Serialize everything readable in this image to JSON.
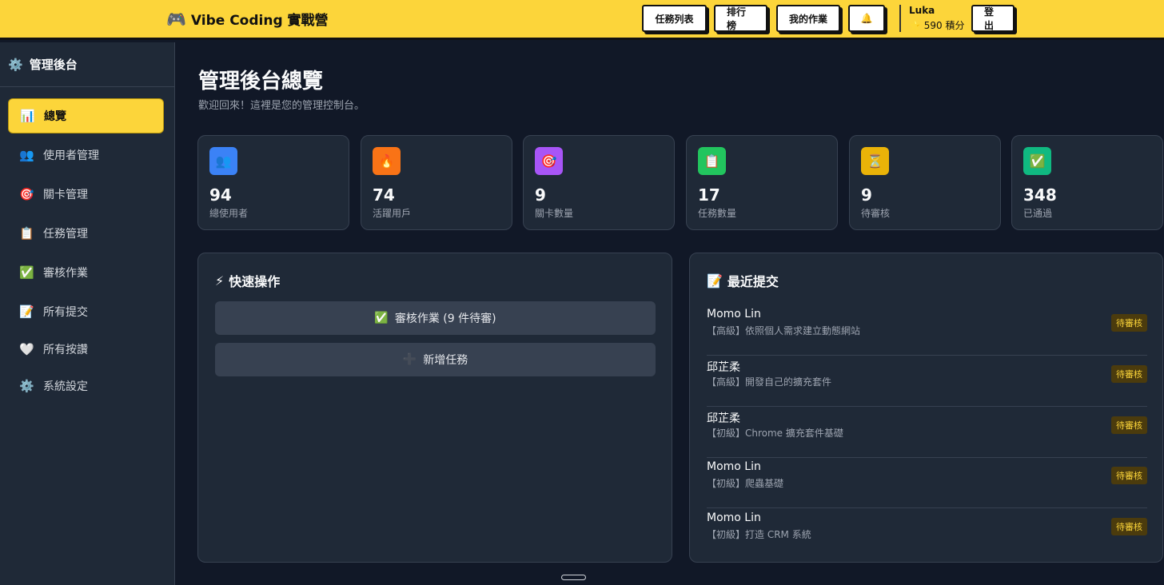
{
  "header": {
    "brand_icon": "🎮",
    "brand": "Vibe Coding 實戰營",
    "nav": [
      "任務列表",
      "排行榜",
      "我的作業"
    ],
    "bell_icon": "🔔",
    "user_name": "Luka",
    "points_icon": "⭐",
    "points": "590 積分",
    "logout": "登出"
  },
  "sidebar": {
    "title_icon": "⚙️",
    "title": "管理後台",
    "items": [
      {
        "icon": "📊",
        "label": "總覽"
      },
      {
        "icon": "👥",
        "label": "使用者管理"
      },
      {
        "icon": "🎯",
        "label": "關卡管理"
      },
      {
        "icon": "📋",
        "label": "任務管理"
      },
      {
        "icon": "✅",
        "label": "審核作業"
      },
      {
        "icon": "📝",
        "label": "所有提交"
      },
      {
        "icon": "🤍",
        "label": "所有按讚"
      },
      {
        "icon": "⚙️",
        "label": "系統設定"
      }
    ]
  },
  "main": {
    "title": "管理後台總覽",
    "subtitle": "歡迎回來！這裡是您的管理控制台。",
    "stats": [
      {
        "icon": "👥",
        "color": "#3b82f6",
        "value": "94",
        "label": "總使用者"
      },
      {
        "icon": "🔥",
        "color": "#f97316",
        "value": "74",
        "label": "活躍用戶"
      },
      {
        "icon": "🎯",
        "color": "#a855f7",
        "value": "9",
        "label": "關卡數量"
      },
      {
        "icon": "📋",
        "color": "#22c55e",
        "value": "17",
        "label": "任務數量"
      },
      {
        "icon": "⏳",
        "color": "#eab308",
        "value": "9",
        "label": "待審核"
      },
      {
        "icon": "✅",
        "color": "#10b981",
        "value": "348",
        "label": "已通過"
      }
    ],
    "quick": {
      "title_icon": "⚡",
      "title": "快速操作",
      "review_icon": "✅",
      "review": "審核作業 (9 件待審)",
      "add_icon": "➕",
      "add": "新增任務"
    },
    "recent": {
      "title_icon": "📝",
      "title": "最近提交",
      "rows": [
        {
          "name": "Momo Lin",
          "task": "【高級】依照個人需求建立動態網站",
          "status": "待審核"
        },
        {
          "name": "邱芷柔",
          "task": "【高級】開發自己的擴充套件",
          "status": "待審核"
        },
        {
          "name": "邱芷柔",
          "task": "【初級】Chrome 擴充套件基礎",
          "status": "待審核"
        },
        {
          "name": "Momo Lin",
          "task": "【初級】爬蟲基礎",
          "status": "待審核"
        },
        {
          "name": "Momo Lin",
          "task": "【初級】打造 CRM 系統",
          "status": "待審核"
        }
      ]
    }
  }
}
